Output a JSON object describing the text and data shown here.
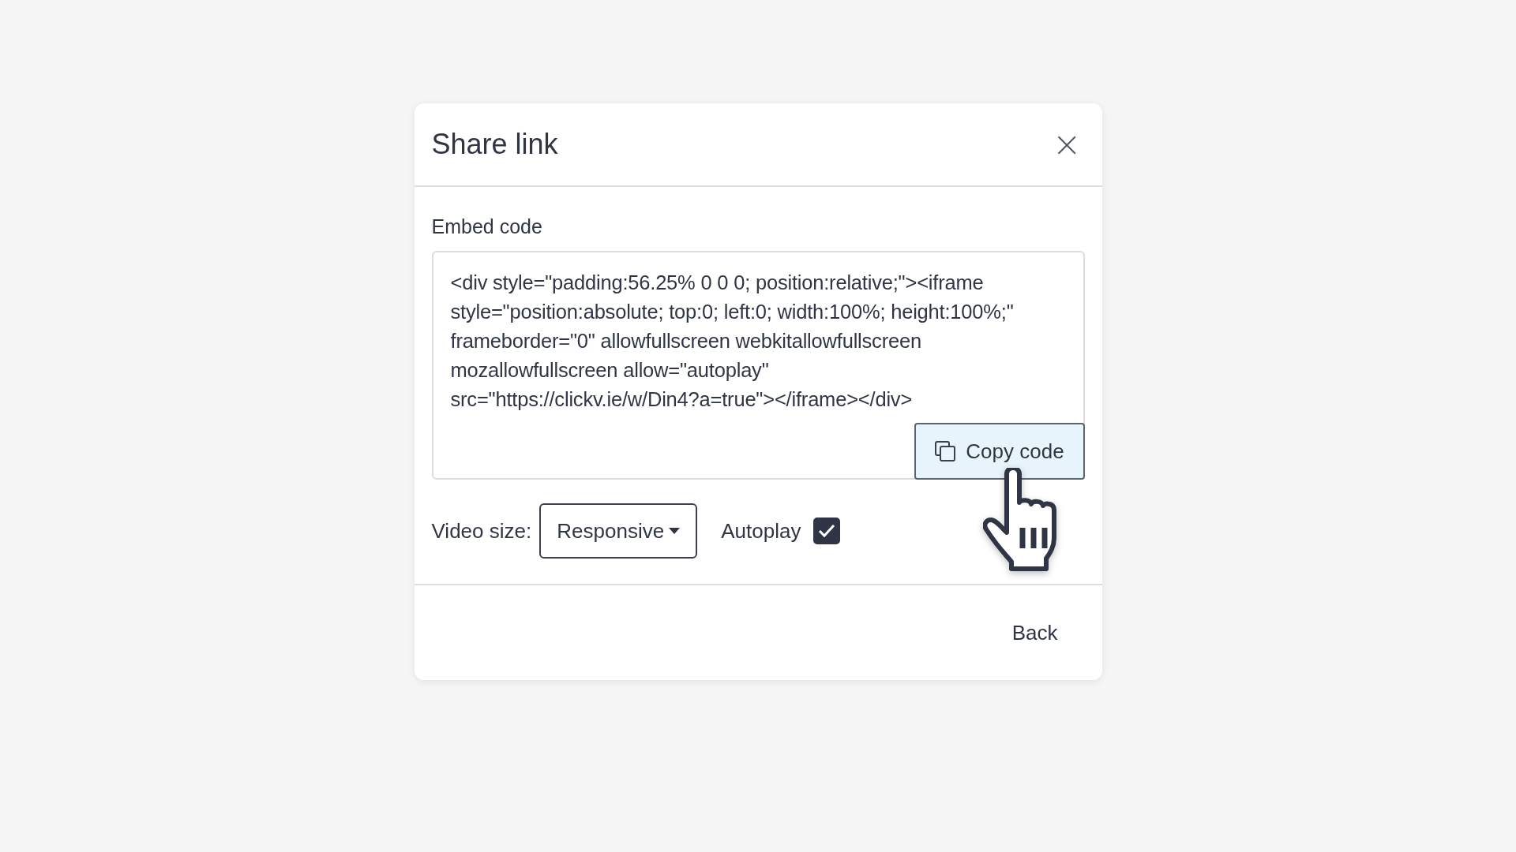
{
  "dialog": {
    "title": "Share link",
    "close_label": "×"
  },
  "embed": {
    "label": "Embed code",
    "code_lines": [
      "<div style=\"padding:56.25% 0 0 0; position:relative;\"><iframe",
      "style=\"position:absolute; top:0; left:0; width:100%; height:100%;\"",
      "frameborder=\"0\" allowfullscreen webkitallowfullscreen",
      "mozallowfullscreen allow=\"autoplay\"",
      "src=\"https://clickv.ie/w/Din4?a=true\"></iframe></div>"
    ],
    "copy_button": "Copy code"
  },
  "options": {
    "size_label": "Video size:",
    "size_value": "Responsive",
    "autoplay_label": "Autoplay",
    "autoplay_checked": true
  },
  "footer": {
    "back_button": "Back"
  }
}
